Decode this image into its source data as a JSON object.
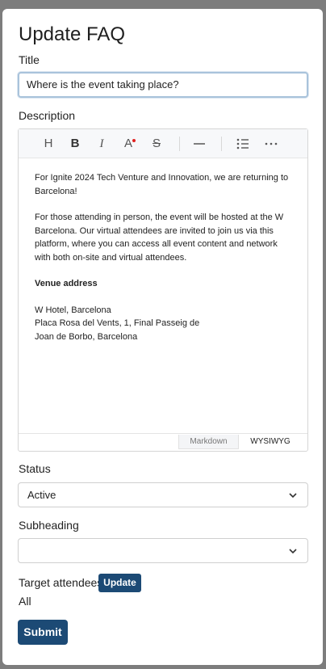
{
  "modal": {
    "title": "Update FAQ",
    "form": {
      "title_label": "Title",
      "title_value": "Where is the event taking place?",
      "description_label": "Description",
      "editor": {
        "toolbar": {
          "heading": "H",
          "bold": "B",
          "italic": "I",
          "text_color": "A",
          "strike": "S"
        },
        "paragraphs": [
          "For Ignite 2024 Tech Venture and Innovation, we are returning to Barcelona!",
          "For those attending in person, the event will be hosted at the W Barcelona. Our virtual attendees are invited to join us via this platform, where you can access all event content and network with both on-site and virtual attendees."
        ],
        "venue_heading": "Venue address",
        "address_lines": [
          "W Hotel, Barcelona",
          "Placa Rosa del Vents, 1, Final Passeig de",
          "Joan de Borbo, Barcelona"
        ],
        "modes": {
          "markdown": "Markdown",
          "wysiwyg": "WYSIWYG"
        }
      },
      "status_label": "Status",
      "status_value": "Active",
      "subheading_label": "Subheading",
      "subheading_value": "",
      "target_label": "Target attendees",
      "target_update_button": "Update",
      "target_value": "All",
      "submit_button": "Submit"
    }
  },
  "colors": {
    "primary": "#1c4a75",
    "overlay": "#7d7d7d",
    "focus_border": "#a9c3db",
    "text_color_dot": "#e02020"
  }
}
